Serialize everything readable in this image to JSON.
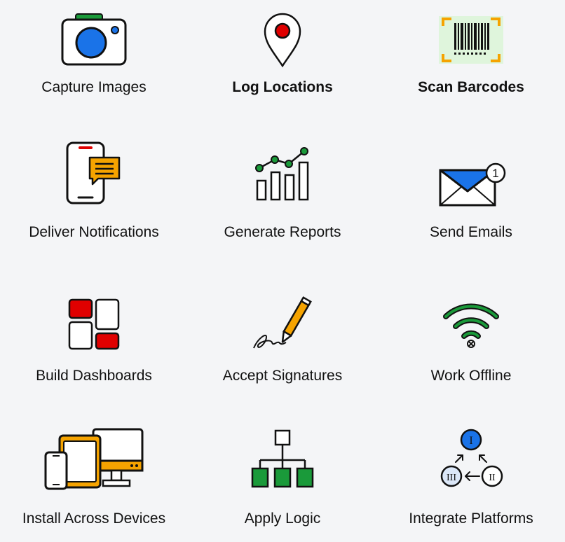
{
  "features": [
    {
      "label": "Capture Images",
      "icon": "camera-icon"
    },
    {
      "label": "Log Locations",
      "icon": "location-pin-icon"
    },
    {
      "label": "Scan Barcodes",
      "icon": "barcode-scanner-icon"
    },
    {
      "label": "Deliver Notifications",
      "icon": "phone-notification-icon"
    },
    {
      "label": "Generate Reports",
      "icon": "report-chart-icon"
    },
    {
      "label": "Send Emails",
      "icon": "email-envelope-icon"
    },
    {
      "label": "Build Dashboards",
      "icon": "dashboard-tiles-icon"
    },
    {
      "label": "Accept Signatures",
      "icon": "signature-pen-icon"
    },
    {
      "label": "Work Offline",
      "icon": "wifi-offline-icon"
    },
    {
      "label": "Install Across Devices",
      "icon": "multi-device-icon"
    },
    {
      "label": "Apply Logic",
      "icon": "logic-tree-icon"
    },
    {
      "label": "Integrate Platforms",
      "icon": "platform-integration-icon"
    }
  ],
  "badges": {
    "email_count": "1",
    "step_one": "I",
    "step_two": "II",
    "step_three": "III"
  },
  "colors": {
    "blue": "#1a73e8",
    "red": "#e00000",
    "green": "#1a9a3a",
    "orange": "#f5a300",
    "light_green": "#dff5dc",
    "light_blue": "#dbe7f8"
  }
}
